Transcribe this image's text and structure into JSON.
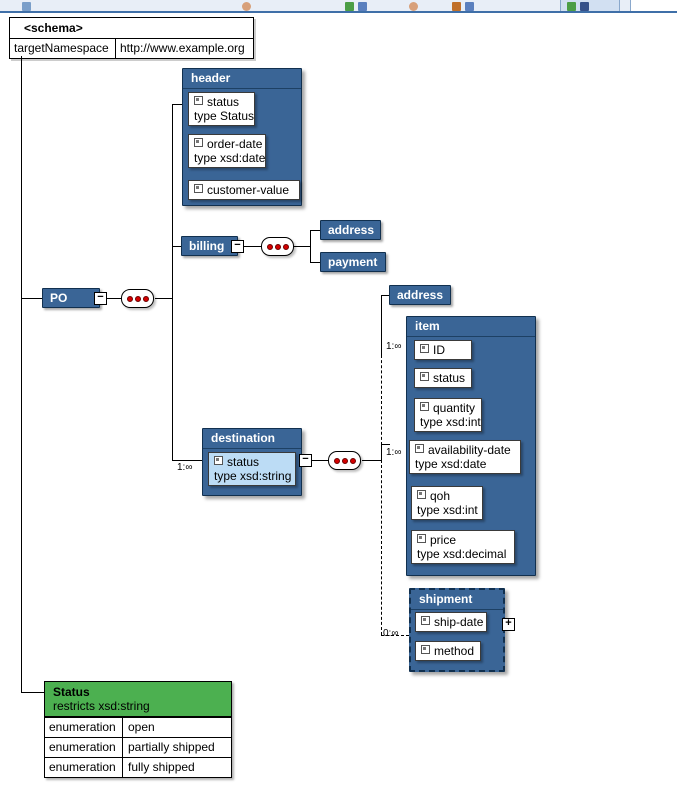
{
  "toolbar": {
    "icons": [
      "window-icon",
      "user-icon",
      "user-icon",
      "green-blue-icon",
      "chart-icon",
      "green-blue-icon"
    ]
  },
  "schema": {
    "title": "<schema>",
    "rows": [
      {
        "key": "targetNamespace",
        "value": "http://www.example.org"
      }
    ]
  },
  "diagram": {
    "root": {
      "label": "PO",
      "toggle": "−"
    },
    "header_type": {
      "title": "header",
      "toggle": "−",
      "fields": [
        {
          "name": "status",
          "type": "type  Status",
          "icon": "attribute-icon"
        },
        {
          "name": "order-date",
          "type": "type  xsd:date",
          "icon": "attribute-icon"
        },
        {
          "name": "customer-value",
          "type": "",
          "icon": "attribute-icon"
        }
      ]
    },
    "billing": {
      "label": "billing",
      "toggle": "−"
    },
    "billing_children": [
      {
        "label": "address"
      },
      {
        "label": "payment"
      }
    ],
    "address_element": {
      "label": "address"
    },
    "destination_type": {
      "title": "destination",
      "toggle": "−",
      "fields": [
        {
          "name": "status",
          "type": "type  xsd:string",
          "icon": "attribute-icon",
          "selected": true
        }
      ]
    },
    "item_type": {
      "title": "item",
      "fields": [
        {
          "name": "ID",
          "type": "",
          "icon": "attribute-icon"
        },
        {
          "name": "status",
          "type": "",
          "icon": "attribute-icon"
        },
        {
          "name": "quantity",
          "type": "type  xsd:int",
          "icon": "attribute-icon"
        },
        {
          "name": "availability-date",
          "type": "type  xsd:date",
          "icon": "attribute-icon"
        },
        {
          "name": "qoh",
          "type": "type  xsd:int",
          "icon": "attribute-icon"
        },
        {
          "name": "price",
          "type": "type  xsd:decimal",
          "icon": "attribute-icon"
        }
      ]
    },
    "shipment_type": {
      "title": "shipment",
      "toggle": "+",
      "fields": [
        {
          "name": "ship-date",
          "type": "",
          "icon": "attribute-icon"
        },
        {
          "name": "method",
          "type": "",
          "icon": "attribute-icon"
        }
      ]
    },
    "cardinalities": {
      "destination": "1:∞",
      "item": "1:∞",
      "item_branch": "1:∞",
      "shipment": "0:∞"
    }
  },
  "simple_type": {
    "name": "Status",
    "restricts": "restricts  xsd:string",
    "facets": [
      {
        "kind": "enumeration",
        "value": "open"
      },
      {
        "kind": "enumeration",
        "value": "partially shipped"
      },
      {
        "kind": "enumeration",
        "value": "fully shipped"
      }
    ]
  },
  "colors": {
    "node_blue": "#3a6596",
    "node_border": "#11304f",
    "selected_chip": "#bcdcf5",
    "simple_type_green": "#4cb050",
    "dot_red": "#d40000"
  }
}
